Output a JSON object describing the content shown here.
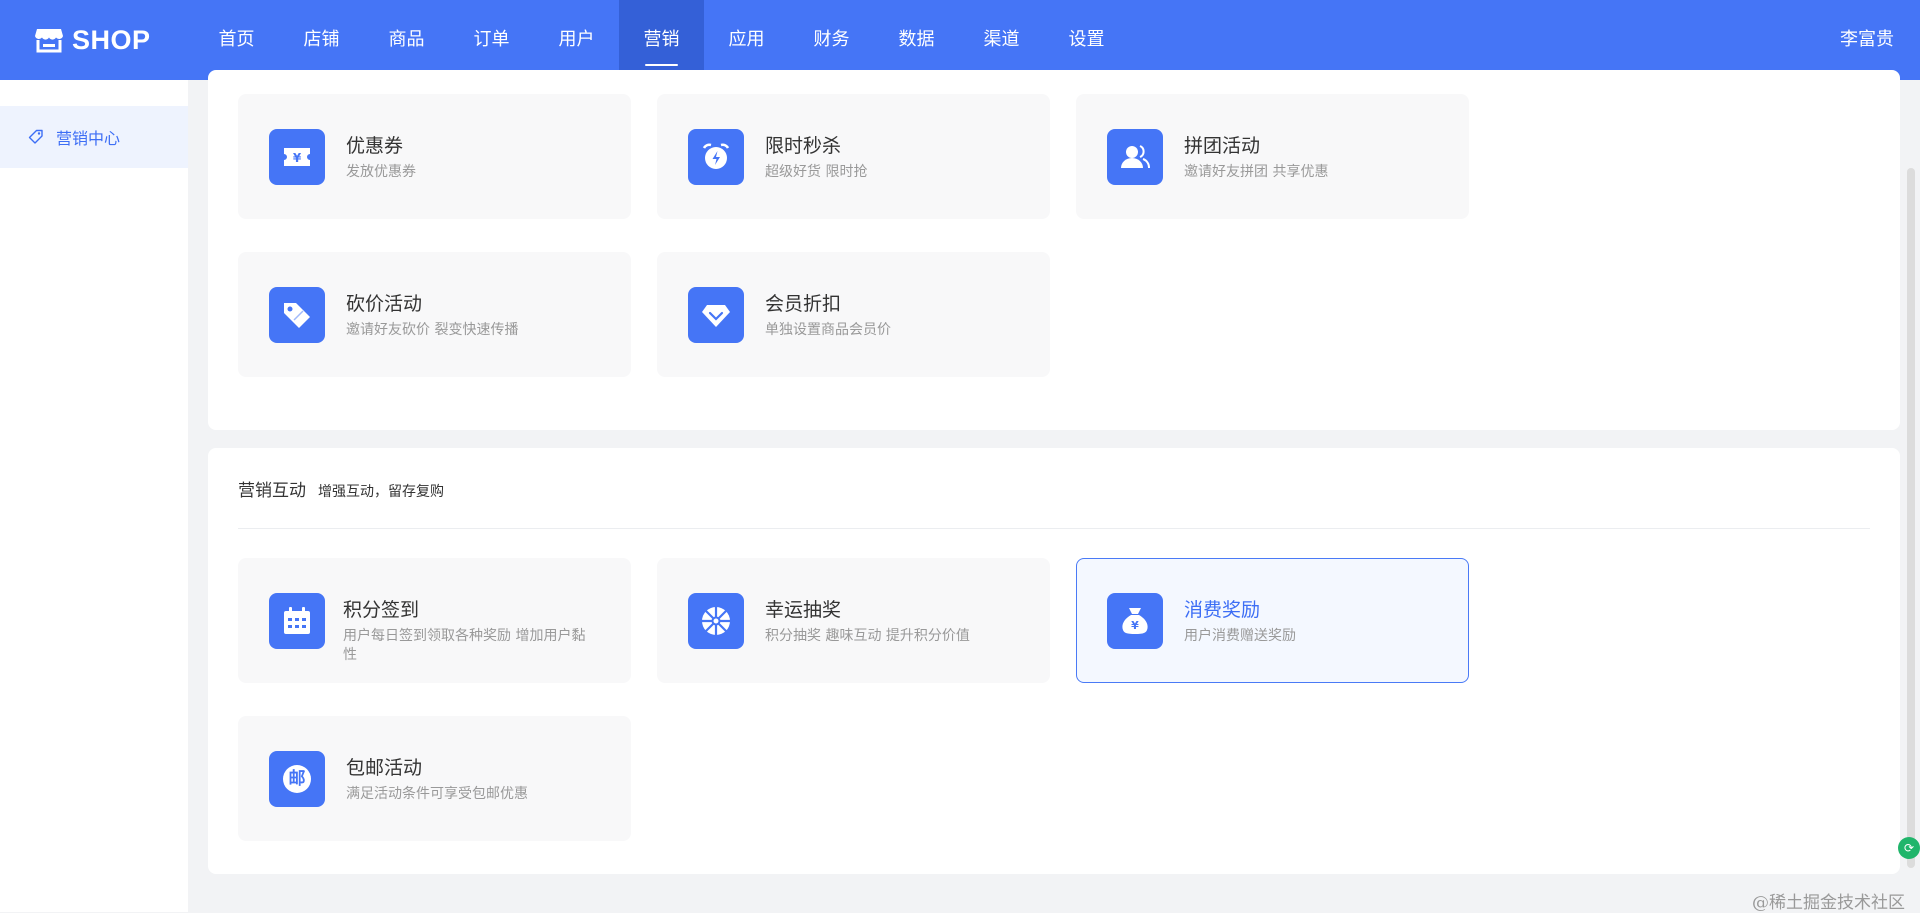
{
  "brand": {
    "name": "SHOP"
  },
  "nav": {
    "items": [
      "首页",
      "店铺",
      "商品",
      "订单",
      "用户",
      "营销",
      "应用",
      "财务",
      "数据",
      "渠道",
      "设置"
    ],
    "active_index": 5
  },
  "user": {
    "name": "李富贵"
  },
  "sidebar": {
    "items": [
      {
        "label": "营销中心",
        "icon": "tag-icon"
      }
    ]
  },
  "sections": [
    {
      "title": "",
      "subtitle": "",
      "cards": [
        {
          "name": "优惠券",
          "desc": "发放优惠券",
          "icon": "coupon-icon"
        },
        {
          "name": "限时秒杀",
          "desc": "超级好货 限时抢",
          "icon": "alarm-clock-icon"
        },
        {
          "name": "拼团活动",
          "desc": "邀请好友拼团 共享优惠",
          "icon": "group-users-icon"
        },
        {
          "name": "砍价活动",
          "desc": "邀请好友砍价 裂变快速传播",
          "icon": "price-tag-icon"
        },
        {
          "name": "会员折扣",
          "desc": "单独设置商品会员价",
          "icon": "diamond-icon"
        }
      ]
    },
    {
      "title": "营销互动",
      "subtitle": "增强互动，留存复购",
      "cards": [
        {
          "name": "积分签到",
          "desc": "用户每日签到领取各种奖励 增加用户黏性",
          "icon": "calendar-icon"
        },
        {
          "name": "幸运抽奖",
          "desc": "积分抽奖 趣味互动 提升积分价值",
          "icon": "lucky-wheel-icon"
        },
        {
          "name": "消费奖励",
          "desc": "用户消费赠送奖励",
          "icon": "money-bag-icon",
          "selected": true
        },
        {
          "name": "包邮活动",
          "desc": "满足活动条件可享受包邮优惠",
          "icon": "postal-stamp-icon",
          "glyph": "邮"
        }
      ]
    }
  ],
  "watermark": "@稀土掘金技术社区",
  "colors": {
    "primary": "#4575f6",
    "nav_active": "#3460d7",
    "sidebar_active_bg": "#eef3fe",
    "text": "#333333",
    "muted": "#999999"
  }
}
